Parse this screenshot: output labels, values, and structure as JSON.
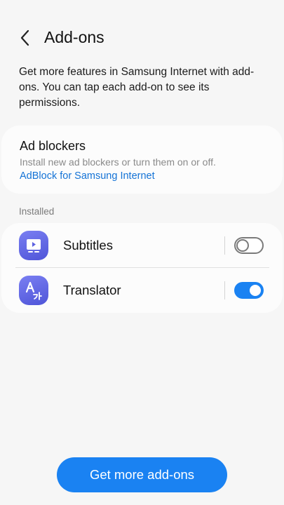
{
  "header": {
    "title": "Add-ons",
    "back_icon": "chevron-left-icon"
  },
  "intro": "Get more features in Samsung Internet with add-ons. You can tap each add-on to see its permissions.",
  "ad_blockers": {
    "title": "Ad blockers",
    "description": "Install new ad blockers or turn them on or off.",
    "link": "AdBlock for Samsung Internet"
  },
  "installed": {
    "label": "Installed",
    "items": [
      {
        "name": "Subtitles",
        "icon": "subtitles-icon",
        "enabled": false
      },
      {
        "name": "Translator",
        "icon": "translator-icon",
        "enabled": true
      }
    ]
  },
  "footer": {
    "button_label": "Get more add-ons"
  },
  "colors": {
    "accent": "#1a82f2",
    "link": "#1473d6",
    "icon_bg": "#5c61e0",
    "background": "#f6f6f6"
  }
}
